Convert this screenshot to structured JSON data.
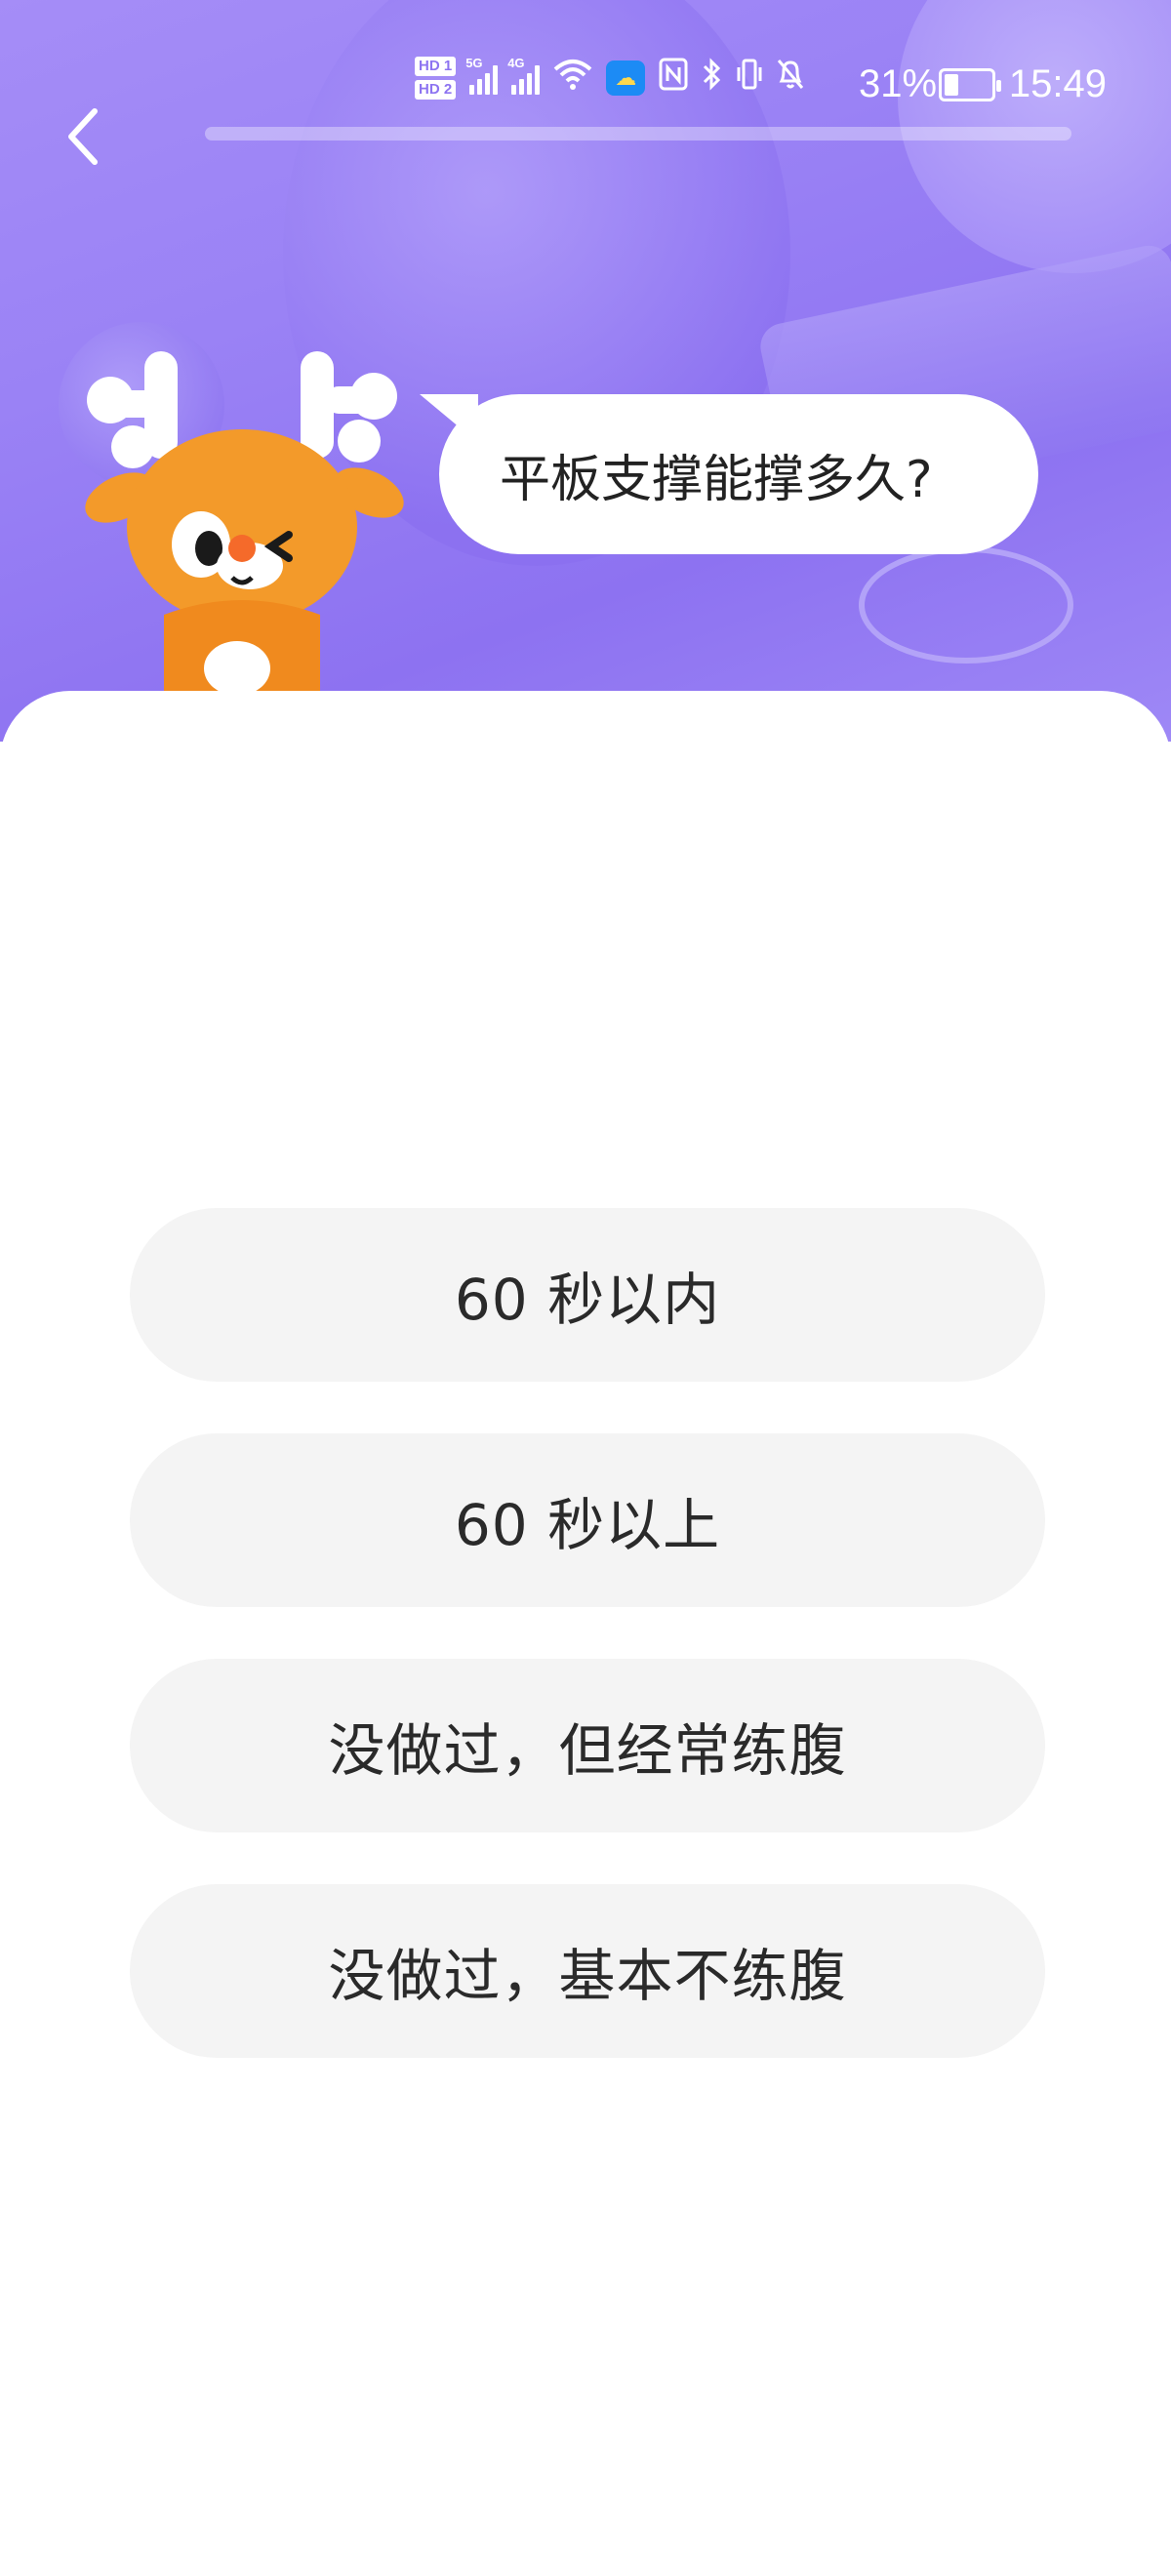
{
  "status_bar": {
    "time": "15:49",
    "battery_percent": "31%",
    "battery_level": 0.31,
    "hd_labels": [
      "HD 1",
      "HD 2"
    ],
    "network_labels": [
      "5G",
      "4G"
    ]
  },
  "header": {
    "progress": 0.0
  },
  "question": {
    "text": "平板支撑能撑多久?"
  },
  "options": [
    {
      "label": "60 秒以内"
    },
    {
      "label": "60 秒以上"
    },
    {
      "label": "没做过，但经常练腹"
    },
    {
      "label": "没做过，基本不练腹"
    }
  ],
  "colors": {
    "hero_background": "#9a82f5",
    "option_background": "#f4f4f4",
    "text_dark": "#2a2a2a",
    "mascot_orange": "#f39a2a"
  },
  "icons": {
    "back": "chevron-left-icon",
    "mascot": "deer-mascot"
  }
}
